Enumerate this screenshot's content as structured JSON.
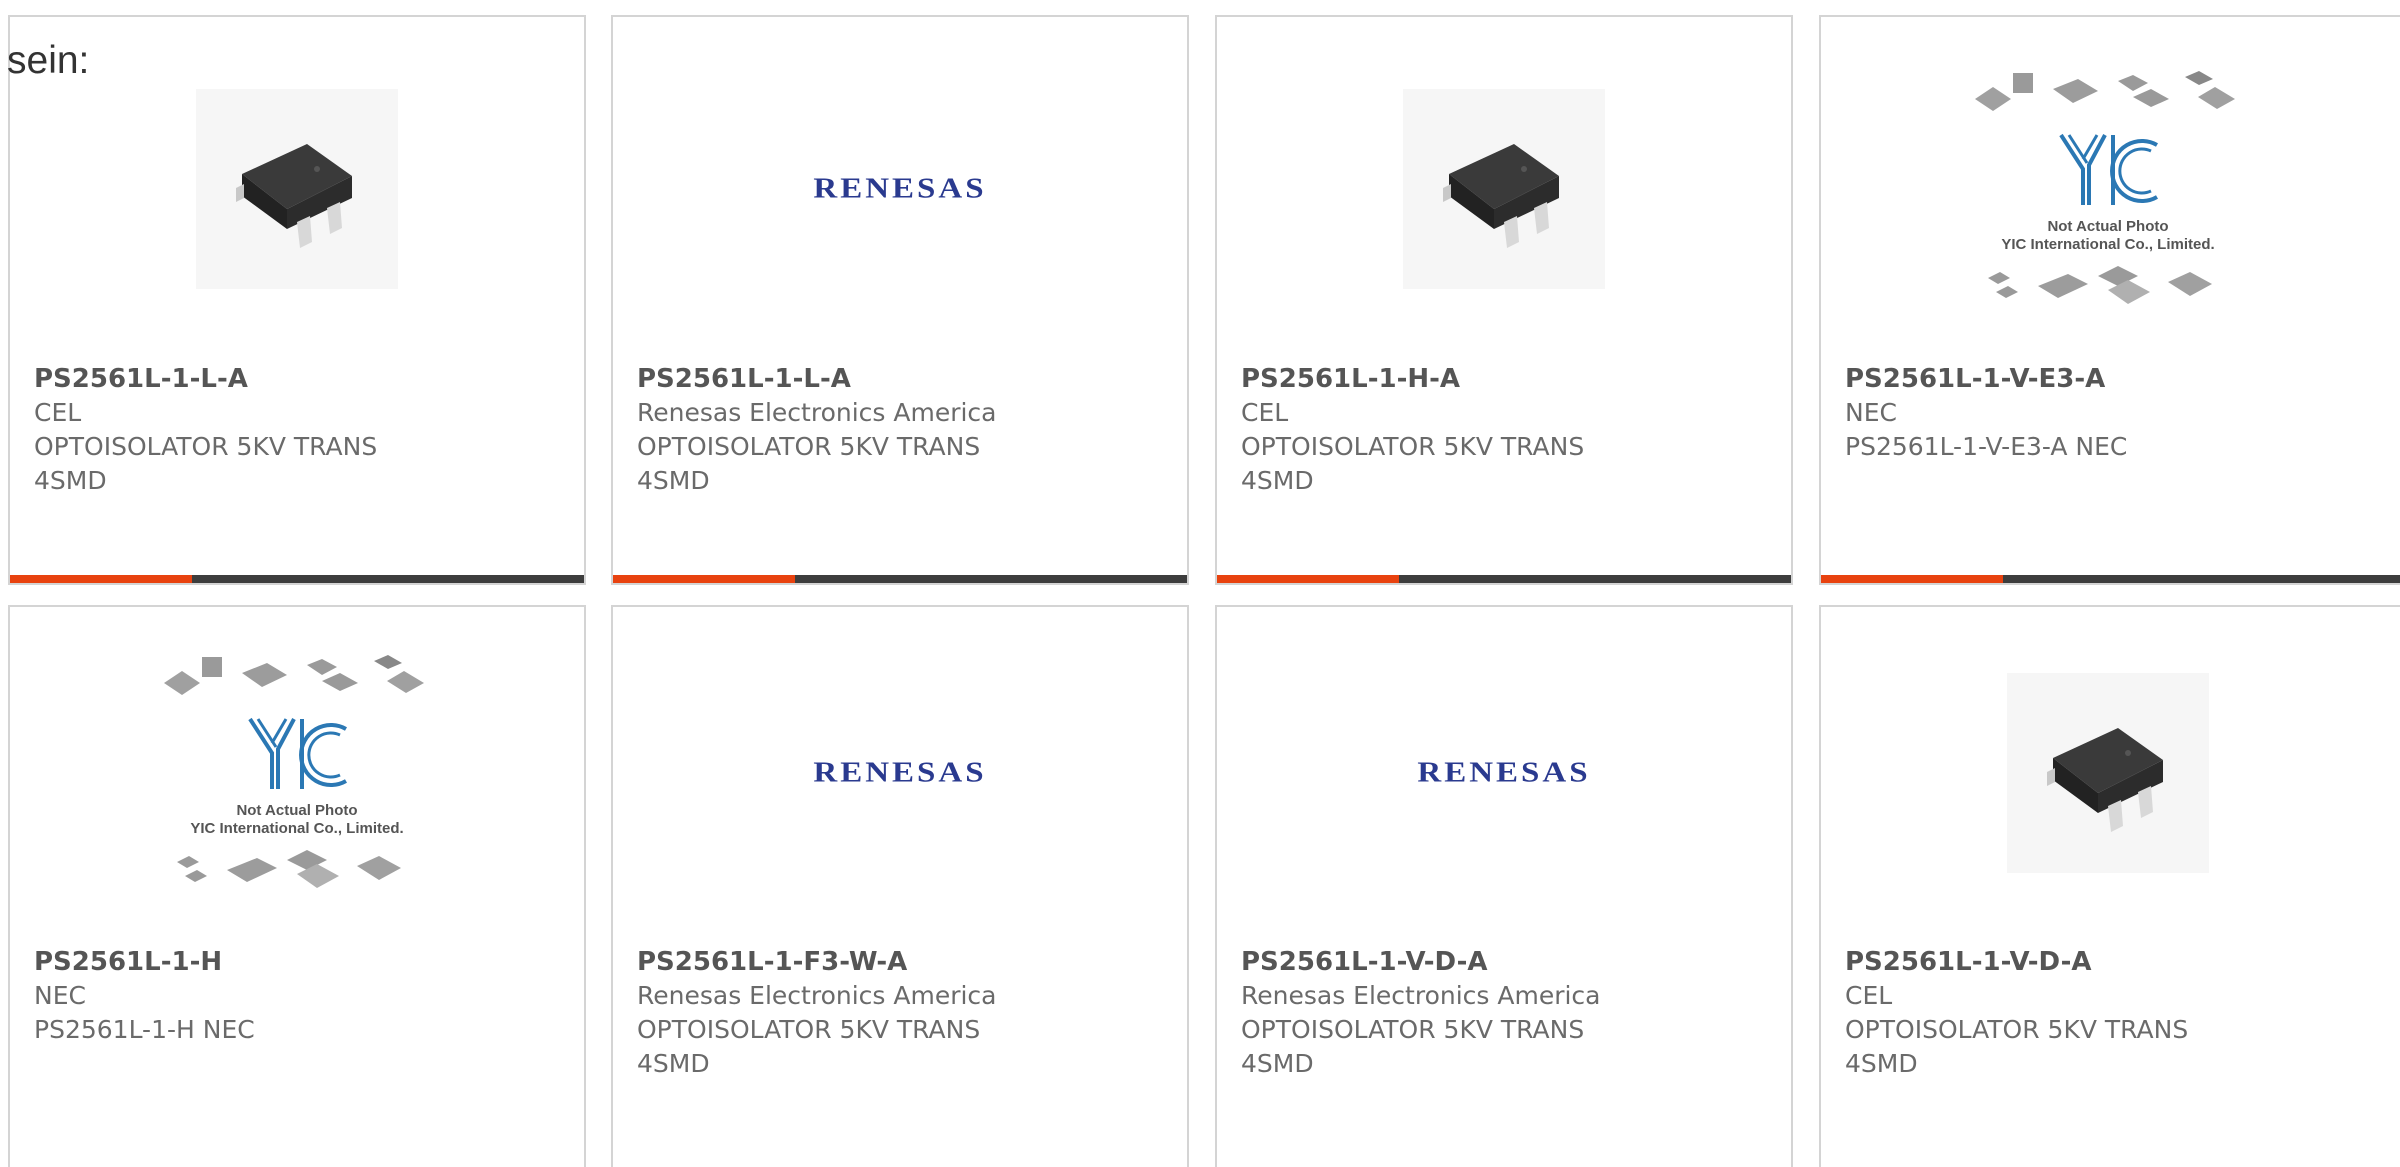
{
  "intro_text": "sein:",
  "accent_color": "#e8420f",
  "placeholder": {
    "brand": "YIC",
    "caption_line1": "Not Actual Photo",
    "caption_line2": "YIC International Co., Limited."
  },
  "renesas_logo_text": "RENESAS",
  "products": [
    {
      "part_number": "PS2561L-1-L-A",
      "manufacturer": "CEL",
      "description_line1": "OPTOISOLATOR 5KV TRANS",
      "description_line2": "4SMD",
      "image": "chip-photo"
    },
    {
      "part_number": "PS2561L-1-L-A",
      "manufacturer": "Renesas Electronics America",
      "description_line1": "OPTOISOLATOR 5KV TRANS",
      "description_line2": "4SMD",
      "image": "renesas-logo"
    },
    {
      "part_number": "PS2561L-1-H-A",
      "manufacturer": "CEL",
      "description_line1": "OPTOISOLATOR 5KV TRANS",
      "description_line2": "4SMD",
      "image": "chip-photo"
    },
    {
      "part_number": "PS2561L-1-V-E3-A",
      "manufacturer": "NEC",
      "description_line1": "PS2561L-1-V-E3-A NEC",
      "description_line2": "",
      "image": "yic-placeholder"
    },
    {
      "part_number": "PS2561L-1-H",
      "manufacturer": "NEC",
      "description_line1": "PS2561L-1-H NEC",
      "description_line2": "",
      "image": "yic-placeholder"
    },
    {
      "part_number": "PS2561L-1-F3-W-A",
      "manufacturer": "Renesas Electronics America",
      "description_line1": "OPTOISOLATOR 5KV TRANS",
      "description_line2": "4SMD",
      "image": "renesas-logo"
    },
    {
      "part_number": "PS2561L-1-V-D-A",
      "manufacturer": "Renesas Electronics America",
      "description_line1": "OPTOISOLATOR 5KV TRANS",
      "description_line2": "4SMD",
      "image": "renesas-logo"
    },
    {
      "part_number": "PS2561L-1-V-D-A",
      "manufacturer": "CEL",
      "description_line1": "OPTOISOLATOR 5KV TRANS",
      "description_line2": "4SMD",
      "image": "chip-photo"
    }
  ]
}
